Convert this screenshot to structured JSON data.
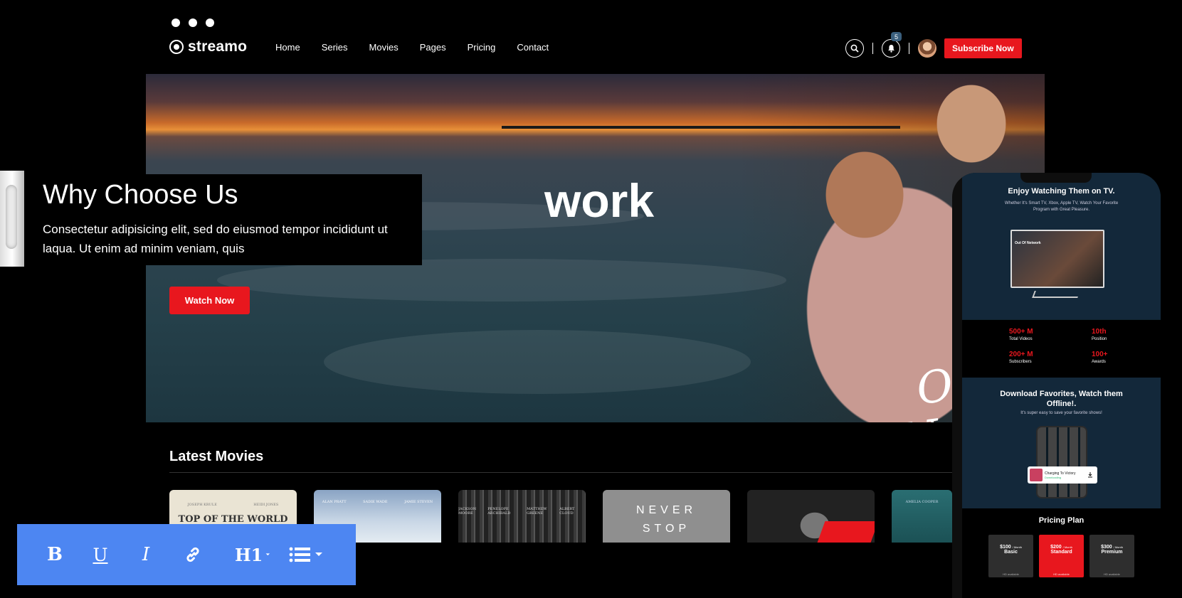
{
  "window": {
    "dots": [
      "dot-1",
      "dot-2",
      "dot-3"
    ]
  },
  "header": {
    "logo_text": "streamo",
    "nav": [
      "Home",
      "Series",
      "Movies",
      "Pages",
      "Pricing",
      "Contact"
    ],
    "notification_count": "5",
    "subscribe_label": "Subscribe Now"
  },
  "hero": {
    "title_fragment": "work",
    "script_title_line1": "Out Of",
    "script_title_line2": "Network",
    "watch_label": "Watch Now"
  },
  "why_choose": {
    "title": "Why Choose Us",
    "text": "Consectetur adipisicing elit, sed do eiusmod tempor incididunt ut laqua. Ut enim ad minim veniam, quis"
  },
  "latest_movies": {
    "title": "Latest Movies",
    "posters": [
      {
        "title": "TOP OF THE WORLD",
        "credits": [
          "JOSEPH KRULE",
          "HEIDI JONES"
        ]
      },
      {
        "credits": [
          "ALAN PRATT",
          "SADIE WADE",
          "JAMIE STEVEN"
        ]
      },
      {
        "credits": [
          "JACKSON MOORE",
          "PENELOPE ARCHIBALD",
          "MATTHEW GREENE",
          "ALBERT CLOUD"
        ]
      },
      {
        "title_line1": "NEVER",
        "title_line2": "STOP"
      },
      {},
      {
        "credits": [
          "AMELIA COOPER"
        ]
      }
    ]
  },
  "toolbar": {
    "bold": "B",
    "underline": "U",
    "italic": "I",
    "heading": "H1"
  },
  "phone": {
    "tv_title": "Enjoy Watching Them on TV.",
    "tv_text": "Whether It's Smart TV, Xbox, Apple TV, Watch Your Favorite Program with Great Pleasure.",
    "tv_screen_title": "Out Of Network",
    "stats": [
      {
        "value": "500+ M",
        "label": "Total Videos"
      },
      {
        "value": "10th",
        "label": "Position"
      },
      {
        "value": "200+ M",
        "label": "Subscribers"
      },
      {
        "value": "100+",
        "label": "Awards"
      }
    ],
    "download_title": "Download Favorites, Watch them Offline!.",
    "download_text": "It's super easy to save your favorite shows!",
    "download_card": "Charging To Victory",
    "download_card_sub": "Downloading",
    "pricing_title": "Pricing Plan",
    "plans": [
      {
        "price": "$100",
        "period": "/ Month",
        "name": "Basic",
        "feature": "HD available"
      },
      {
        "price": "$200",
        "period": "/ Month",
        "name": "Standard",
        "feature": "HD available"
      },
      {
        "price": "$300",
        "period": "/ Month",
        "name": "Premium",
        "feature": "HD available"
      }
    ]
  },
  "colors": {
    "accent": "#e8171e",
    "toolbar": "#4d86f2",
    "phone_panel": "#13283a"
  }
}
